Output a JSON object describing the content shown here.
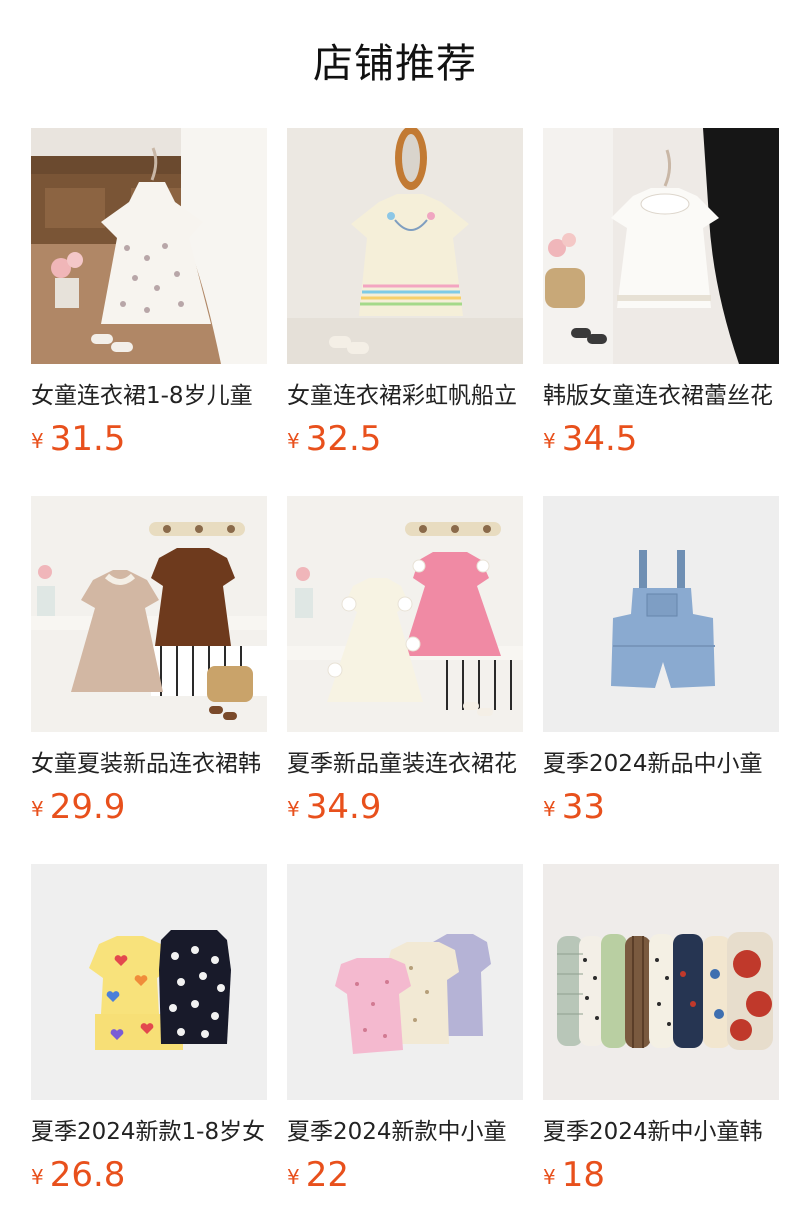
{
  "header": {
    "title": "店铺推荐"
  },
  "currency_symbol": "¥",
  "products": [
    {
      "name": "女童连衣裙1-8岁儿童",
      "price": "31.5",
      "image_icon": "floral-dress-photo"
    },
    {
      "name": "女童连衣裙彩虹帆船立",
      "price": "32.5",
      "image_icon": "rainbow-dress-photo"
    },
    {
      "name": "韩版女童连衣裙蕾丝花",
      "price": "34.5",
      "image_icon": "lace-dress-photo"
    },
    {
      "name": "女童夏装新品连衣裙韩",
      "price": "29.9",
      "image_icon": "two-dresses-photo"
    },
    {
      "name": "夏季新品童装连衣裙花",
      "price": "34.9",
      "image_icon": "flower-dresses-photo"
    },
    {
      "name": "夏季2024新品中小童",
      "price": "33",
      "image_icon": "denim-overalls-photo"
    },
    {
      "name": "夏季2024新款1-8岁女",
      "price": "26.8",
      "image_icon": "heart-dot-sets-photo"
    },
    {
      "name": "夏季2024新款中小童",
      "price": "22",
      "image_icon": "pastel-sets-photo"
    },
    {
      "name": "夏季2024新中小童韩",
      "price": "18",
      "image_icon": "pants-row-photo"
    }
  ],
  "colors": {
    "price": "#e8501c",
    "title": "#111111",
    "text": "#222222"
  }
}
